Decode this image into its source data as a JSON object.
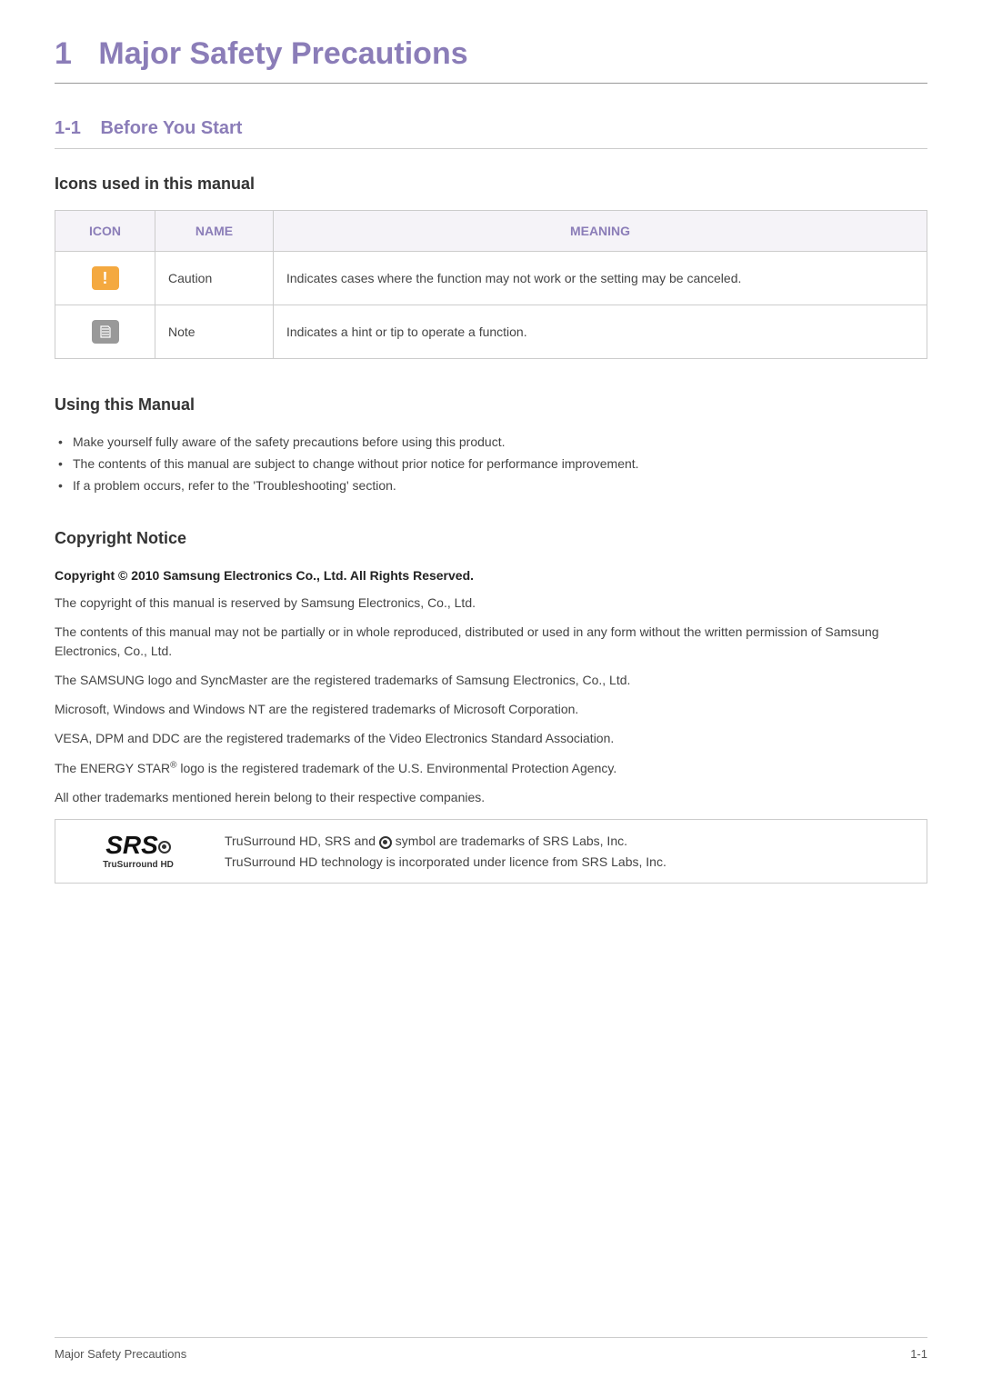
{
  "chapter": {
    "number": "1",
    "title": "Major Safety Precautions"
  },
  "section": {
    "number": "1-1",
    "title": "Before You Start"
  },
  "icons_section": {
    "heading": "Icons used in this manual",
    "headers": {
      "icon": "ICON",
      "name": "NAME",
      "meaning": "MEANING"
    },
    "rows": [
      {
        "name": "Caution",
        "meaning": "Indicates cases where the function may not work or the setting may be canceled."
      },
      {
        "name": "Note",
        "meaning": "Indicates a hint or tip to operate a function."
      }
    ]
  },
  "using_manual": {
    "heading": "Using this Manual",
    "items": [
      "Make yourself fully aware of the safety precautions before using this product.",
      "The contents of this manual are subject to change without prior notice for performance improvement.",
      "If a problem occurs, refer to the 'Troubleshooting' section."
    ]
  },
  "copyright": {
    "heading": "Copyright Notice",
    "bold_line": "Copyright ©  2010 Samsung Electronics Co., Ltd. All Rights Reserved.",
    "paragraphs": [
      "The copyright of this manual is reserved by Samsung Electronics, Co., Ltd.",
      "The contents of this manual may not be partially or in whole reproduced, distributed or used in any form without the written permission of Samsung Electronics, Co., Ltd.",
      "The SAMSUNG logo and SyncMaster are the registered trademarks of Samsung Electronics, Co., Ltd.",
      "Microsoft, Windows and Windows NT are the registered trademarks of Microsoft Corporation.",
      "VESA, DPM and DDC are the registered trademarks of the Video Electronics Standard Association.",
      "The ENERGY STAR® logo is the registered trademark of the U.S. Environmental Protection Agency.",
      "All other trademarks mentioned herein belong to their respective companies."
    ]
  },
  "srs_box": {
    "logo_main": "SRS",
    "logo_sub": "TruSurround HD",
    "line1_a": "TruSurround HD, SRS and ",
    "line1_b": " symbol are trademarks of SRS Labs, Inc.",
    "line2": "TruSurround HD technology is incorporated under licence from SRS Labs, Inc."
  },
  "footer": {
    "left": "Major Safety Precautions",
    "right": "1-1"
  }
}
